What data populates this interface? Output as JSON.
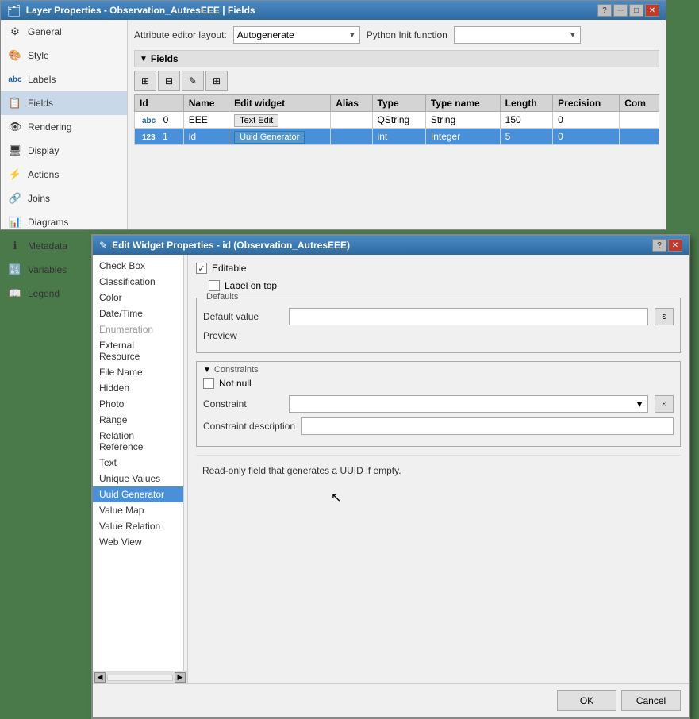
{
  "mainWindow": {
    "title": "Layer Properties - Observation_AutresEEE | Fields",
    "icon": "🗂"
  },
  "toolbar": {
    "attributeEditorLabel": "Attribute editor layout:",
    "attributeEditorValue": "Autogenerate",
    "pythonInitLabel": "Python Init function"
  },
  "fieldsSection": {
    "title": "Fields"
  },
  "tableHeaders": [
    "Id",
    "Name",
    "Edit widget",
    "Alias",
    "Type",
    "Type name",
    "Length",
    "Precision",
    "Com"
  ],
  "tableRows": [
    {
      "typeBadge": "abc",
      "id": "0",
      "name": "EEE",
      "widget": "Text Edit",
      "alias": "",
      "type": "QString",
      "typeName": "String",
      "length": "150",
      "precision": "0",
      "comment": "",
      "selected": false
    },
    {
      "typeBadge": "123",
      "id": "1",
      "name": "id",
      "widget": "Uuid Generator",
      "alias": "",
      "type": "int",
      "typeName": "Integer",
      "length": "5",
      "precision": "0",
      "comment": "",
      "selected": true
    }
  ],
  "sidebar": {
    "items": [
      {
        "label": "General",
        "icon": "⚙"
      },
      {
        "label": "Style",
        "icon": "🎨"
      },
      {
        "label": "Labels",
        "icon": "abc"
      },
      {
        "label": "Fields",
        "icon": "📋",
        "active": true
      },
      {
        "label": "Rendering",
        "icon": "👁"
      },
      {
        "label": "Display",
        "icon": "🖥"
      },
      {
        "label": "Actions",
        "icon": "⚡",
        "active": false
      },
      {
        "label": "Joins",
        "icon": "🔗"
      },
      {
        "label": "Diagrams",
        "icon": "📊"
      },
      {
        "label": "Metadata",
        "icon": "ℹ"
      },
      {
        "label": "Variables",
        "icon": "🔣"
      },
      {
        "label": "Legend",
        "icon": "📖"
      }
    ]
  },
  "dialog": {
    "title": "Edit Widget Properties - id (Observation_AutresEEE)",
    "widgetList": [
      {
        "label": "Check Box",
        "active": false
      },
      {
        "label": "Classification",
        "active": false
      },
      {
        "label": "Color",
        "active": false
      },
      {
        "label": "Date/Time",
        "active": false
      },
      {
        "label": "Enumeration",
        "active": false,
        "disabled": true
      },
      {
        "label": "External Resource",
        "active": false
      },
      {
        "label": "File Name",
        "active": false
      },
      {
        "label": "Hidden",
        "active": false
      },
      {
        "label": "Photo",
        "active": false
      },
      {
        "label": "Range",
        "active": false
      },
      {
        "label": "Relation Reference",
        "active": false
      },
      {
        "label": "Text",
        "active": false
      },
      {
        "label": "Unique Values",
        "active": false
      },
      {
        "label": "Uuid Generator",
        "active": true
      },
      {
        "label": "Value Map",
        "active": false
      },
      {
        "label": "Value Relation",
        "active": false
      },
      {
        "label": "Web View",
        "active": false
      }
    ],
    "editable": {
      "label": "Editable",
      "checked": true
    },
    "labelOnTop": {
      "label": "Label on top",
      "checked": false
    },
    "defaults": {
      "title": "Defaults",
      "defaultValueLabel": "Default value",
      "defaultValue": "",
      "previewLabel": "Preview",
      "previewValue": ""
    },
    "constraints": {
      "title": "Constraints",
      "notNullLabel": "Not null",
      "notNullChecked": false,
      "constraintLabel": "Constraint",
      "constraintValue": "",
      "constraintDescLabel": "Constraint description",
      "constraintDescValue": ""
    },
    "description": "Read-only field that generates a UUID if empty.",
    "buttons": {
      "ok": "OK",
      "cancel": "Cancel"
    }
  },
  "icons": {
    "collapse": "▼",
    "expand": "▶",
    "close": "✕",
    "minimize": "─",
    "maximize": "□",
    "help": "?",
    "epsilon": "ε",
    "arrow_down": "▼",
    "arrow_left": "◀",
    "arrow_right": "▶"
  }
}
